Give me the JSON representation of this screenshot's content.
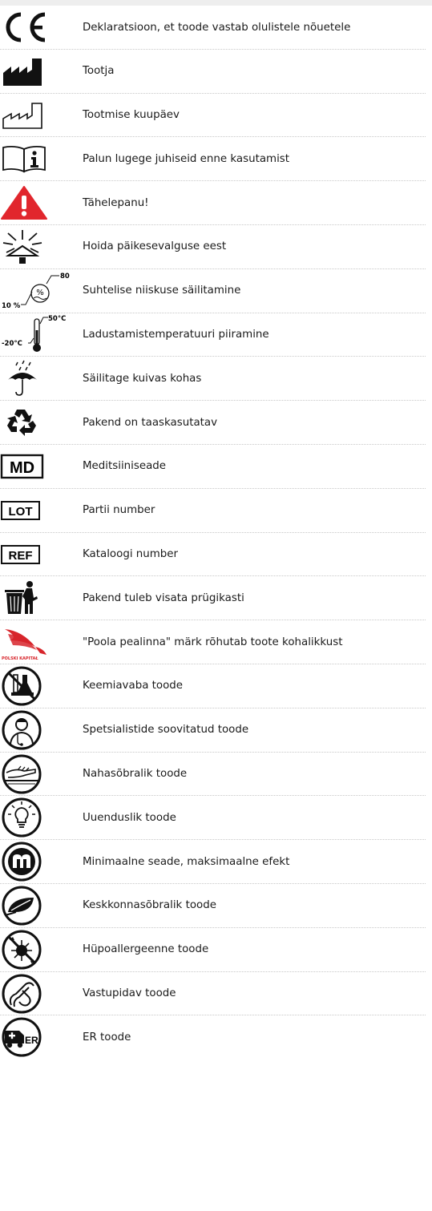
{
  "rows": [
    {
      "icon": "ce-mark-icon",
      "label": "Deklaratsioon, et toode vastab olulistele nõuetele"
    },
    {
      "icon": "manufacturer-icon",
      "label": "Tootja"
    },
    {
      "icon": "manufacture-date-icon",
      "label": "Tootmise kuupäev"
    },
    {
      "icon": "instructions-icon",
      "label": "Palun lugege juhiseid enne kasutamist"
    },
    {
      "icon": "warning-icon",
      "label": "Tähelepanu!"
    },
    {
      "icon": "keep-away-sunlight-icon",
      "label": "Hoida päikesevalguse eest"
    },
    {
      "icon": "humidity-limit-icon",
      "label": "Suhtelise niiskuse säilitamine",
      "icon_text": {
        "max": "80 %",
        "min": "10 %",
        "symbol": "%"
      }
    },
    {
      "icon": "temperature-limit-icon",
      "label": "Ladustamistemperatuuri piiramine",
      "icon_text": {
        "max": "50°C",
        "min": "-20°C"
      }
    },
    {
      "icon": "keep-dry-icon",
      "label": "Säilitage kuivas kohas"
    },
    {
      "icon": "recycle-icon",
      "label": "Pakend on taaskasutatav"
    },
    {
      "icon": "md-icon",
      "label": "Meditsiiniseade",
      "icon_text": "MD"
    },
    {
      "icon": "lot-icon",
      "label": "Partii number",
      "icon_text": "LOT"
    },
    {
      "icon": "ref-icon",
      "label": "Kataloogi number",
      "icon_text": "REF"
    },
    {
      "icon": "trash-bin-icon",
      "label": "Pakend tuleb visata prügikasti"
    },
    {
      "icon": "polish-capital-logo-icon",
      "label": "\"Poola pealinna\" märk rõhutab toote kohalikkust",
      "icon_text": "POLSKI KAPITAŁ"
    },
    {
      "icon": "chemical-free-icon",
      "label": "Keemiavaba toode"
    },
    {
      "icon": "specialist-recommended-icon",
      "label": "Spetsialistide soovitatud toode"
    },
    {
      "icon": "skin-friendly-icon",
      "label": "Nahasõbralik toode"
    },
    {
      "icon": "innovative-icon",
      "label": "Uuenduslik toode"
    },
    {
      "icon": "minimal-device-icon",
      "label": "Minimaalne seade, maksimaalne efekt"
    },
    {
      "icon": "eco-friendly-icon",
      "label": "Keskkonnasõbralik toode"
    },
    {
      "icon": "hypoallergenic-icon",
      "label": "Hüpoallergeenne toode"
    },
    {
      "icon": "durable-icon",
      "label": "Vastupidav toode"
    },
    {
      "icon": "er-product-icon",
      "label": "ER toode",
      "icon_text": "ER"
    }
  ],
  "colors": {
    "warning_red": "#e1262d",
    "logo_red": "#d7252b",
    "ink": "#111111"
  }
}
